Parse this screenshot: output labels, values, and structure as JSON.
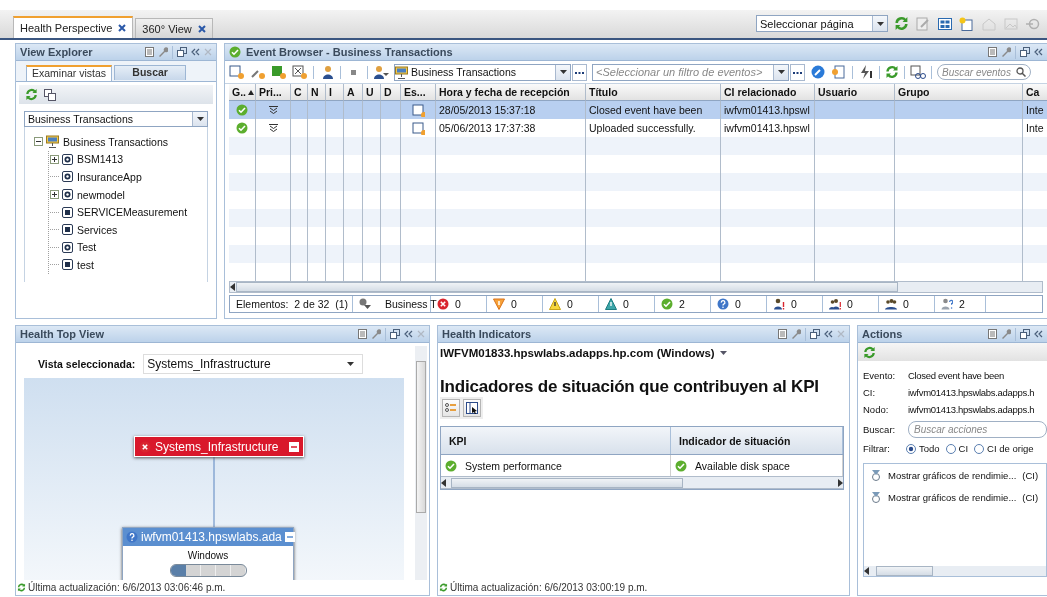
{
  "tabs": [
    {
      "label": "Health Perspective",
      "selected": true
    },
    {
      "label": "360° View",
      "selected": false
    }
  ],
  "page_select": {
    "value": "Seleccionar página"
  },
  "view_explorer": {
    "title": "View Explorer",
    "tabs": [
      {
        "label": "Examinar vistas",
        "selected": true
      },
      {
        "label": "Buscar",
        "selected": false
      }
    ],
    "view_select": {
      "value": "Business Transactions"
    },
    "tree": [
      {
        "label": "Business Transactions",
        "kind": "business",
        "expanded": true,
        "children": [
          {
            "label": "BSM1413",
            "kind": "ci",
            "expanded": false
          },
          {
            "label": "InsuranceApp",
            "kind": "ci"
          },
          {
            "label": "newmodel",
            "kind": "ci",
            "expanded": false
          },
          {
            "label": "SERVICEMeasurement",
            "kind": "group"
          },
          {
            "label": "Services",
            "kind": "group"
          },
          {
            "label": "Test",
            "kind": "ci"
          },
          {
            "label": "test",
            "kind": "group"
          }
        ]
      }
    ]
  },
  "event_browser": {
    "title": "Event Browser - Business Transactions",
    "view_select": {
      "value": "Business Transactions"
    },
    "filter_select": {
      "placeholder": "<Seleccionar un filtro de eventos>"
    },
    "search": {
      "placeholder": "Buscar eventos"
    },
    "columns": [
      {
        "label": "G..",
        "sorted": true
      },
      {
        "label": "Pri...",
        "sorted": false
      },
      {
        "label": "C",
        "sorted": false
      },
      {
        "label": "N",
        "sorted": false
      },
      {
        "label": "I",
        "sorted": false
      },
      {
        "label": "A",
        "sorted": false
      },
      {
        "label": "U",
        "sorted": false
      },
      {
        "label": "D",
        "sorted": false
      },
      {
        "label": "Es...",
        "sorted": false
      },
      {
        "label": "Hora y fecha de recepción",
        "sorted": false
      },
      {
        "label": "Título",
        "sorted": false
      },
      {
        "label": "CI relacionado",
        "sorted": false
      },
      {
        "label": "Usuario",
        "sorted": false
      },
      {
        "label": "Grupo",
        "sorted": false
      },
      {
        "label": "Ca",
        "sorted": false
      }
    ],
    "rows": [
      {
        "selected": true,
        "date": "28/05/2013 15:37:18",
        "title": "Closed event have been",
        "ci": "iwfvm01413.hpswl",
        "category": "Inte"
      },
      {
        "selected": false,
        "date": "05/06/2013 17:37:38",
        "title": "Uploaded successfully.",
        "ci": "iwfvm01413.hpswl",
        "category": "Inte"
      }
    ],
    "status_bar": {
      "count_text": "Elementos:  2 de 32  (1)",
      "view": "Business T",
      "counts": [
        {
          "kind": "critical",
          "count": "0"
        },
        {
          "kind": "major",
          "count": "0"
        },
        {
          "kind": "minor",
          "count": "0"
        },
        {
          "kind": "warning",
          "count": "0"
        },
        {
          "kind": "normal",
          "count": "2"
        },
        {
          "kind": "unknown",
          "count": "0"
        },
        {
          "kind": "user_alert",
          "count": "0"
        },
        {
          "kind": "users_alert",
          "count": "0"
        },
        {
          "kind": "users",
          "count": "0"
        },
        {
          "kind": "user_unknown",
          "count": "2"
        }
      ]
    }
  },
  "health_top_view": {
    "title": "Health Top View",
    "view_label": "Vista seleccionada:",
    "view_select": {
      "value": "Systems_Infrastructure"
    },
    "nodes": [
      {
        "label": "Systems_Infrastructure",
        "kind": "critical"
      },
      {
        "label": "iwfvm01413.hpswlabs.ada",
        "kind": "unknown",
        "type": "Windows",
        "level": 0.2
      }
    ],
    "updated": "Última actualización: 6/6/2013 03:06:46 p.m."
  },
  "health_indicators": {
    "title": "Health Indicators",
    "ci_select": {
      "value": "IWFVM01833.hpswlabs.adapps.hp.com (Windows)"
    },
    "heading": "Indicadores de situación que contribuyen al KPI",
    "columns": [
      "KPI",
      "Indicador de situación"
    ],
    "rows": [
      {
        "kpi": "System performance",
        "indicator": "Available disk space"
      }
    ],
    "updated": "Última actualización: 6/6/2013 03:00:19 p.m."
  },
  "actions": {
    "title": "Actions",
    "fields": [
      {
        "label": "Evento:",
        "value": "Closed event have been"
      },
      {
        "label": "CI:",
        "value": "iwfvm01413.hpswlabs.adapps.h"
      },
      {
        "label": "Nodo:",
        "value": "iwfvm01413.hpswlabs.adapps.h"
      }
    ],
    "search": {
      "label": "Buscar:",
      "placeholder": "Buscar acciones"
    },
    "filter": {
      "label": "Filtrar:",
      "options": [
        {
          "label": "Todo",
          "selected": true
        },
        {
          "label": "CI",
          "selected": false
        },
        {
          "label": "CI de orige",
          "selected": false
        }
      ]
    },
    "items": [
      {
        "label": "Mostrar gráficos de rendimie...",
        "scope": "(CI)"
      },
      {
        "label": "Mostrar gráficos de rendimie...",
        "scope": "(CI)"
      }
    ]
  }
}
